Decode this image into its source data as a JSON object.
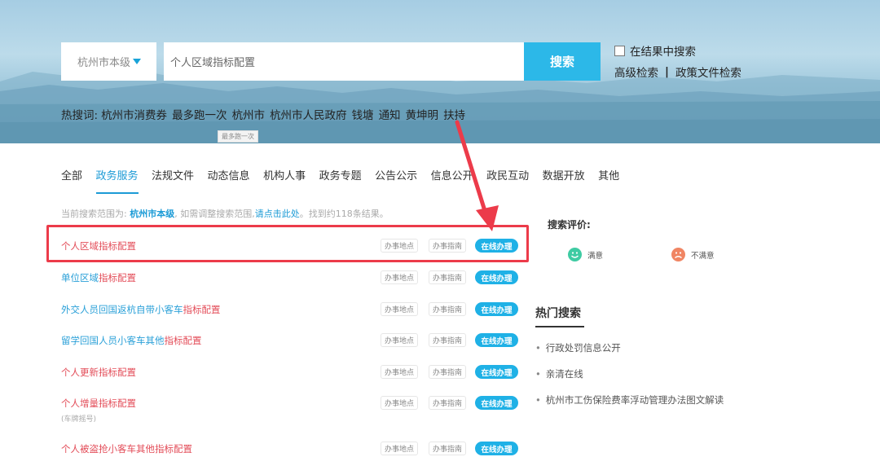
{
  "search": {
    "region": "杭州市本级",
    "query": "个人区域指标配置",
    "button": "搜索",
    "in_results": "在结果中搜索",
    "advanced": "高级检索",
    "separator": "|",
    "policy": "政策文件检索",
    "hot_label": "热搜词:",
    "hot_terms": [
      "杭州市消费券",
      "最多跑一次",
      "杭州市",
      "杭州市人民政府",
      "钱塘",
      "通知",
      "黄坤明",
      "扶持"
    ],
    "tooltip": "最多跑一次"
  },
  "tabs": [
    "全部",
    "政务服务",
    "法规文件",
    "动态信息",
    "机构人事",
    "政务专题",
    "公告公示",
    "信息公开",
    "政民互动",
    "数据开放",
    "其他"
  ],
  "active_tab": "政务服务",
  "scope": {
    "prefix": "当前搜索范围为:",
    "region": "杭州市本级",
    "mid": ", 如需调整搜索范围,",
    "link": "请点击此处",
    "suffix": "。找到约118条结果。"
  },
  "result_buttons": {
    "location": "办事地点",
    "guide": "办事指南",
    "online": "在线办理"
  },
  "results": [
    {
      "blue": "",
      "red": "个人区域指标配置"
    },
    {
      "blue": "单位区域",
      "red": "指标配置"
    },
    {
      "blue": "外交人员回国返杭自带小客车",
      "red": "指标配置"
    },
    {
      "blue": "留学回国人员小客车其他",
      "red": "指标配置"
    },
    {
      "blue": "",
      "red": "个人更新指标配置"
    },
    {
      "blue": "",
      "red": "个人增量指标配置",
      "sub": "(车牌摇号)"
    },
    {
      "blue": "",
      "red": "个人被盗抢小客车其他指标配置"
    }
  ],
  "evaluation": {
    "title": "搜索评价:",
    "satisfied": "满意",
    "unsatisfied": "不满意"
  },
  "hot_search": {
    "title": "热门搜索",
    "items": [
      "行政处罚信息公开",
      "亲清在线",
      "杭州市工伤保险费率浮动管理办法图文解读"
    ]
  },
  "colors": {
    "accent": "#1c9bd6",
    "search_button": "#2cb8e8",
    "highlight": "#ec3b4a",
    "result_title": "#e34d59"
  }
}
